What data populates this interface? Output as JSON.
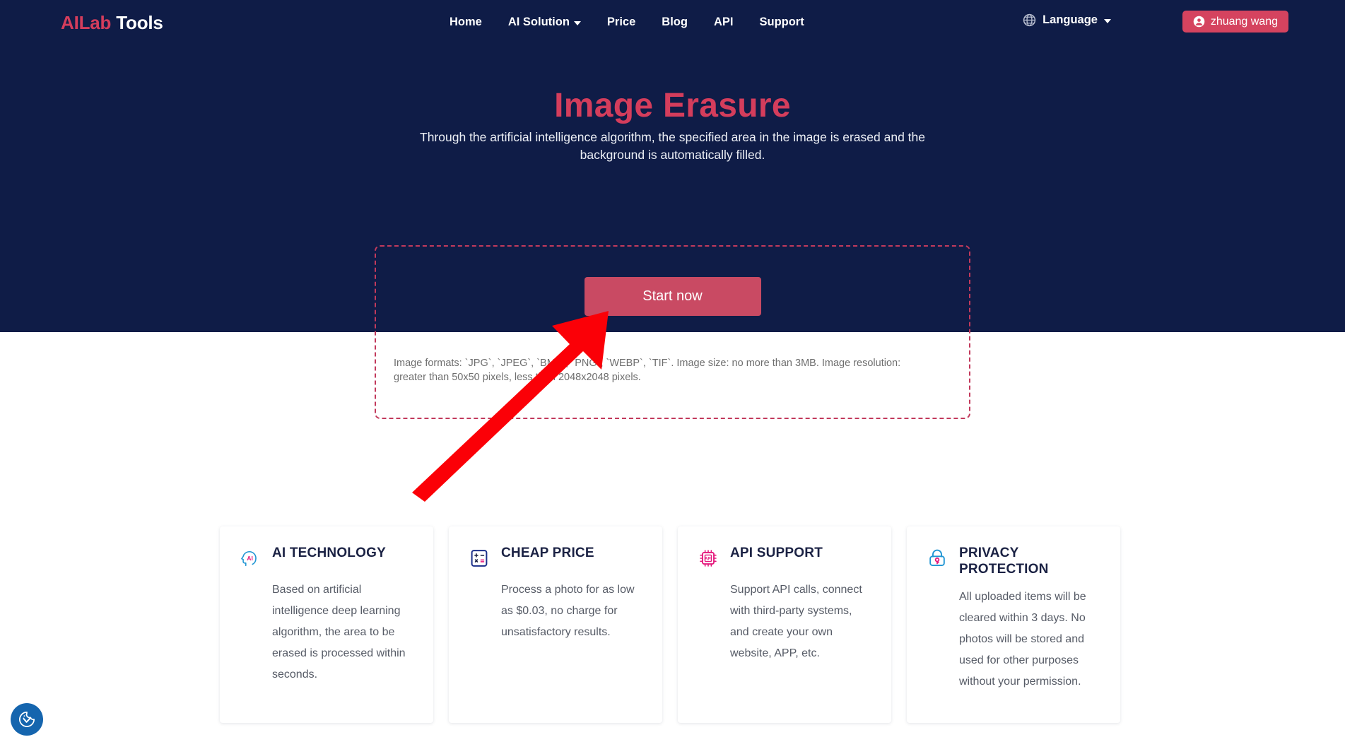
{
  "header": {
    "brand_first": "AILab",
    "brand_second": "Tools",
    "nav": [
      {
        "label": "Home",
        "has_caret": false
      },
      {
        "label": "AI Solution",
        "has_caret": true
      },
      {
        "label": "Price",
        "has_caret": false
      },
      {
        "label": "Blog",
        "has_caret": false
      },
      {
        "label": "API",
        "has_caret": false
      },
      {
        "label": "Support",
        "has_caret": false
      }
    ],
    "language_label": "Language",
    "language_icon": "globe-icon",
    "user_name": "zhuang wang",
    "user_icon": "user-circle-icon"
  },
  "hero": {
    "title": "Image Erasure",
    "subtitle": "Through the artificial intelligence algorithm, the specified area in the image is erased and the background is automatically filled."
  },
  "dropzone": {
    "start_label": "Start now",
    "formats_text": "Image formats: `JPG`, `JPEG`, `BMP`, `PNG`, `WEBP`, `TIF`. Image size: no more than 3MB. Image resolution: greater than 50x50 pixels, less than 2048x2048 pixels."
  },
  "annotation": {
    "type": "arrow",
    "color": "#fb0007",
    "points_to": "start-now-button"
  },
  "cards": [
    {
      "icon": "ai-head-icon",
      "title": "AI TECHNOLOGY",
      "body": "Based on artificial intelligence deep learning algorithm, the area to be erased is processed within seconds."
    },
    {
      "icon": "calculator-icon",
      "title": "CHEAP PRICE",
      "body": "Process a photo for as low as $0.03, no charge for unsatisfactory results."
    },
    {
      "icon": "api-chip-icon",
      "title": "API SUPPORT",
      "body": "Support API calls, connect with third-party systems, and create your own website, APP, etc."
    },
    {
      "icon": "lock-icon",
      "title": "PRIVACY PROTECTION",
      "body": "All uploaded items will be cleared within 3 days. No photos will be stored and used for other purposes without your permission."
    }
  ],
  "cookie_badge": {
    "icon": "cookie-check-icon"
  },
  "colors": {
    "hero_bg": "#0f1c47",
    "accent": "#d43d5c",
    "button": "#c94a63",
    "annotation": "#fb0007",
    "cookie": "#1565ae"
  }
}
